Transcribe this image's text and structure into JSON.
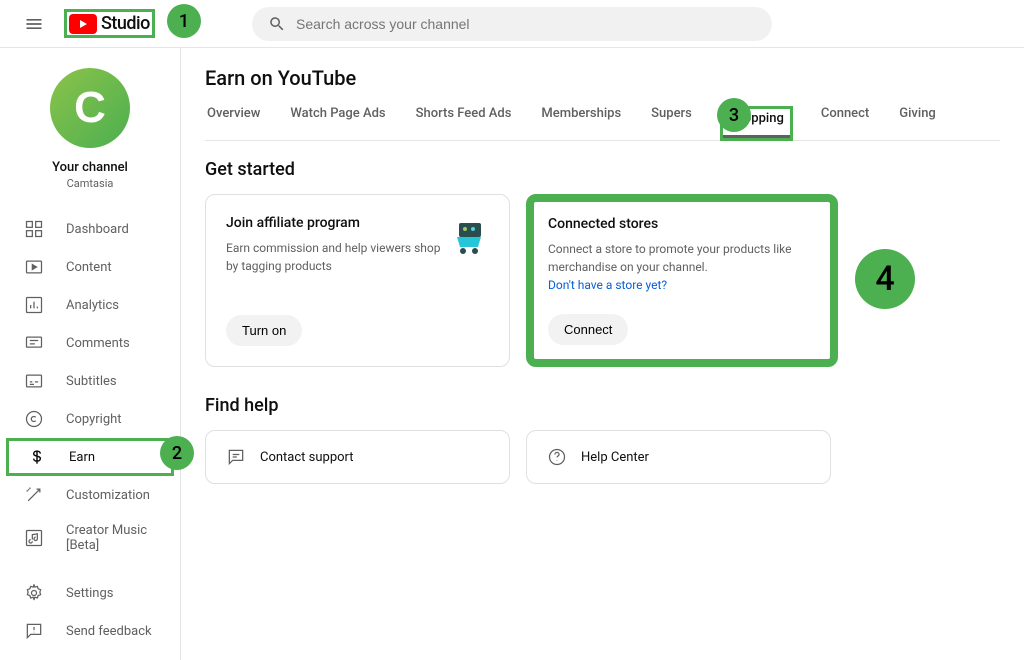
{
  "header": {
    "logo_text": "Studio",
    "search_placeholder": "Search across your channel"
  },
  "sidebar": {
    "channel_label": "Your channel",
    "channel_name": "Camtasia",
    "items": [
      {
        "label": "Dashboard"
      },
      {
        "label": "Content"
      },
      {
        "label": "Analytics"
      },
      {
        "label": "Comments"
      },
      {
        "label": "Subtitles"
      },
      {
        "label": "Copyright"
      },
      {
        "label": "Earn"
      },
      {
        "label": "Customization"
      },
      {
        "label": "Creator Music [Beta]"
      }
    ],
    "bottom": [
      {
        "label": "Settings"
      },
      {
        "label": "Send feedback"
      }
    ]
  },
  "page": {
    "title": "Earn on YouTube",
    "tabs": [
      {
        "label": "Overview"
      },
      {
        "label": "Watch Page Ads"
      },
      {
        "label": "Shorts Feed Ads"
      },
      {
        "label": "Memberships"
      },
      {
        "label": "Supers"
      },
      {
        "label": "Shopping"
      },
      {
        "label": "Connect"
      },
      {
        "label": "Giving"
      }
    ],
    "sections": {
      "get_started": "Get started",
      "find_help": "Find help"
    },
    "cards": {
      "affiliate": {
        "title": "Join affiliate program",
        "body": "Earn commission and help viewers shop by tagging products",
        "button": "Turn on"
      },
      "stores": {
        "title": "Connected stores",
        "body": "Connect a store to promote your products like merchandise on your channel.",
        "link": "Don't have a store yet?",
        "button": "Connect"
      }
    },
    "help": {
      "contact": "Contact support",
      "center": "Help Center"
    }
  },
  "annotations": [
    "1",
    "2",
    "3",
    "4"
  ]
}
